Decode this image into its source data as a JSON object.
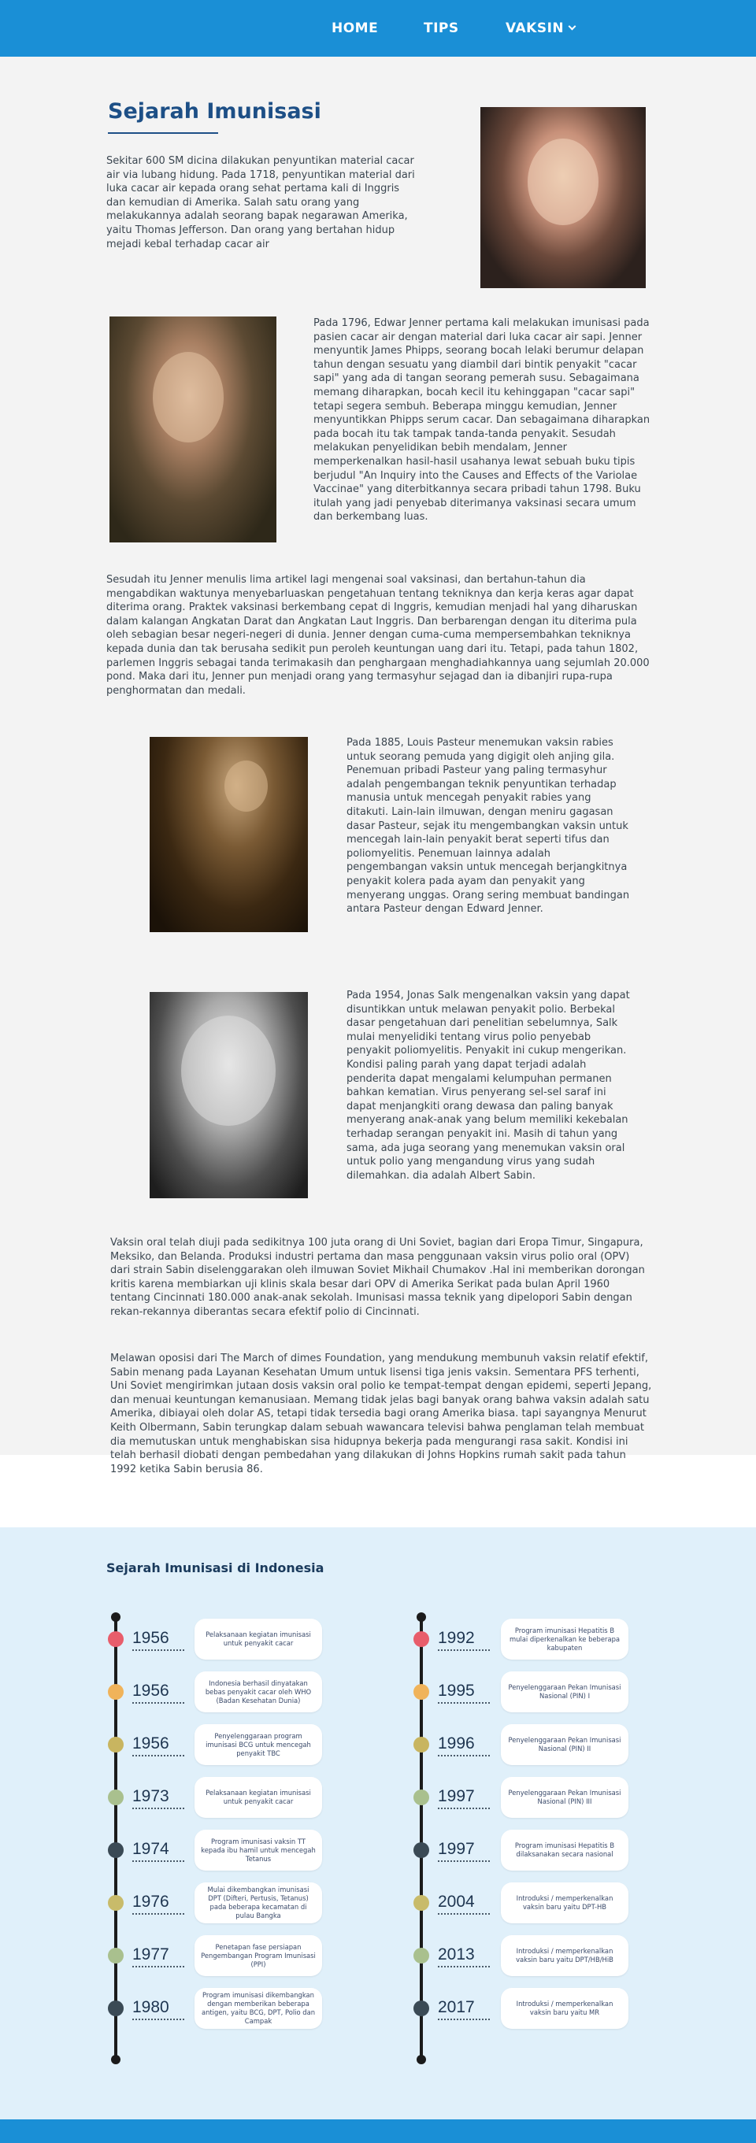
{
  "nav": {
    "home": "HOME",
    "tips": "TIPS",
    "vaksin": "VAKSIN"
  },
  "main": {
    "title": "Sejarah Imunisasi",
    "p1": "Sekitar 600 SM dicina dilakukan penyuntikan material cacar air via lubang hidung. Pada 1718, penyuntikan material dari luka cacar air kepada orang sehat pertama kali di Inggris dan kemudian di Amerika. Salah satu orang yang melakukannya adalah seorang bapak negarawan Amerika, yaitu Thomas Jefferson. Dan orang yang bertahan hidup mejadi kebal terhadap cacar air",
    "p2": "Pada 1796, Edwar Jenner pertama kali melakukan imunisasi pada pasien cacar air dengan material dari luka cacar air sapi. Jenner menyuntik James Phipps, seorang bocah lelaki berumur delapan tahun dengan sesuatu yang diambil dari bintik penyakit \"cacar sapi\" yang ada di tangan seorang pemerah susu. Sebagaimana memang diharapkan, bocah kecil itu kehinggapan \"cacar sapi\" tetapi segera sembuh. Beberapa minggu kemudian, Jenner menyuntikkan Phipps serum cacar. Dan sebagaimana diharapkan pada bocah itu tak tampak tanda-tanda penyakit. Sesudah melakukan penyelidikan bebih mendalam, Jenner memperkenalkan hasil-hasil usahanya lewat sebuah buku tipis berjudul \"An Inquiry into the Causes and Effects of the Variolae Vaccinae\" yang diterbitkannya secara pribadi tahun 1798. Buku itulah yang jadi penyebab diterimanya vaksinasi secara umum dan berkembang luas.",
    "p3": "Sesudah itu Jenner menulis lima artikel lagi mengenai soal vaksinasi, dan bertahun-tahun dia mengabdikan waktunya menyebarluaskan pengetahuan tentang tekniknya dan kerja keras agar dapat diterima orang. Praktek vaksinasi berkembang cepat di Inggris, kemudian menjadi hal yang diharuskan dalam kalangan Angkatan Darat dan Angkatan Laut Inggris. Dan berbarengan dengan itu diterima pula oleh sebagian besar negeri-negeri di dunia. Jenner dengan cuma-cuma mempersembahkan tekniknya kepada dunia dan tak berusaha sedikit pun peroleh keuntungan uang dari itu. Tetapi, pada tahun 1802, parlemen Inggris sebagai tanda terimakasih dan penghargaan menghadiahkannya uang sejumlah 20.000 pond. Maka dari itu, Jenner pun menjadi orang yang termasyhur sejagad dan ia dibanjiri rupa-rupa penghormatan dan medali.",
    "p4": "Pada 1885, Louis Pasteur menemukan vaksin rabies untuk seorang pemuda yang digigit oleh anjing gila. Penemuan pribadi Pasteur yang paling termasyhur adalah pengembangan teknik penyuntikan terhadap manusia untuk mencegah penyakit rabies yang ditakuti. Lain-lain ilmuwan, dengan meniru gagasan dasar Pasteur, sejak itu mengembangkan vaksin untuk mencegah lain-lain penyakit berat seperti tifus dan poliomyelitis. Penemuan lainnya adalah pengembangan vaksin untuk mencegah berjangkitnya penyakit kolera pada ayam dan penyakit yang menyerang unggas. Orang sering membuat bandingan antara Pasteur dengan Edward Jenner.",
    "p5": "Pada 1954, Jonas Salk mengenalkan vaksin yang dapat disuntikkan untuk melawan penyakit polio. Berbekal dasar pengetahuan dari penelitian sebelumnya, Salk mulai menyelidiki tentang virus polio penyebab penyakit poliomyelitis. Penyakit ini cukup mengerikan. Kondisi paling parah yang dapat terjadi adalah penderita dapat mengalami kelumpuhan permanen bahkan kematian. Virus penyerang sel-sel saraf ini dapat menjangkiti orang dewasa dan paling banyak menyerang anak-anak yang belum memiliki kekebalan terhadap serangan penyakit ini. Masih di tahun yang sama, ada juga seorang yang menemukan vaksin oral untuk polio yang mengandung virus yang sudah dilemahkan. dia adalah Albert Sabin.",
    "p6": " Vaksin oral telah diuji pada sedikitnya 100 juta orang di Uni Soviet, bagian dari Eropa Timur, Singapura, Meksiko, dan Belanda. Produksi industri pertama dan masa penggunaan vaksin virus polio oral (OPV) dari strain Sabin diselenggarakan oleh ilmuwan Soviet Mikhail Chumakov .Hal ini memberikan dorongan kritis karena membiarkan uji klinis skala besar dari OPV di Amerika Serikat pada bulan April 1960 tentang Cincinnati 180.000 anak-anak sekolah. Imunisasi massa teknik yang dipelopori Sabin dengan rekan-rekannya diberantas secara efektif polio di Cincinnati.",
    "p7": "Melawan oposisi dari The March of dimes Foundation, yang mendukung membunuh vaksin relatif efektif, Sabin menang pada Layanan Kesehatan Umum untuk lisensi tiga jenis vaksin. Sementara PFS terhenti, Uni Soviet mengirimkan jutaan dosis vaksin oral polio ke tempat-tempat dengan epidemi, seperti Jepang, dan menuai keuntungan kemanusiaan. Memang tidak jelas bagi banyak orang bahwa vaksin adalah satu Amerika, dibiayai oleh dolar AS, tetapi tidak tersedia bagi orang Amerika biasa. tapi sayangnya Menurut Keith Olbermann, Sabin terungkap dalam sebuah wawancara televisi bahwa penglaman telah membuat dia memutuskan untuk menghabiskan sisa hidupnya bekerja pada mengurangi rasa sakit. Kondisi ini telah berhasil diobati dengan pembedahan yang dilakukan di Johns Hopkins rumah sakit pada tahun 1992 ketika Sabin berusia 86."
  },
  "timeline": {
    "title": "Sejarah Imunisasi di Indonesia",
    "left": [
      {
        "year": "1956",
        "color": "#e85d6b",
        "text": "Pelaksanaan kegiatan imunisasi untuk penyakit cacar"
      },
      {
        "year": "1956",
        "color": "#f0b35a",
        "text": "Indonesia berhasil dinyatakan bebas penyakit cacar oleh WHO (Badan Kesehatan Dunia)"
      },
      {
        "year": "1956",
        "color": "#c8b560",
        "text": "Penyelenggaraan program imunisasi BCG untuk mencegah penyakit TBC"
      },
      {
        "year": "1973",
        "color": "#a9c08e",
        "text": "Pelaksanaan kegiatan imunisasi untuk penyakit cacar"
      },
      {
        "year": "1974",
        "color": "#3a4a55",
        "text": "Program imunisasi vaksin TT kepada ibu hamil untuk mencegah Tetanus"
      },
      {
        "year": "1976",
        "color": "#c8bb6a",
        "text": "Mulai dikembangkan imunisasi DPT (Difteri, Pertusis, Tetanus) pada beberapa kecamatan di pulau Bangka"
      },
      {
        "year": "1977",
        "color": "#a9c08e",
        "text": "Penetapan fase persiapan Pengembangan Program Imunisasi (PPI)"
      },
      {
        "year": "1980",
        "color": "#3a4a55",
        "text": "Program imunisasi dikembangkan dengan memberikan beberapa antigen, yaitu BCG, DPT, Polio dan Campak"
      }
    ],
    "right": [
      {
        "year": "1992",
        "color": "#e85d6b",
        "text": "Program imunisasi Hepatitis B mulai diperkenalkan ke beberapa kabupaten"
      },
      {
        "year": "1995",
        "color": "#f0b35a",
        "text": "Penyelenggaraan Pekan Imunisasi Nasional (PIN) I"
      },
      {
        "year": "1996",
        "color": "#c8b560",
        "text": "Penyelenggaraan Pekan Imunisasi Nasional (PIN) II"
      },
      {
        "year": "1997",
        "color": "#a9c08e",
        "text": "Penyelenggaraan Pekan Imunisasi Nasional (PIN) III"
      },
      {
        "year": "1997",
        "color": "#3a4a55",
        "text": "Program imunisasi Hepatitis B dilaksanakan secara nasional"
      },
      {
        "year": "2004",
        "color": "#c8bb6a",
        "text": "Introduksi / memperkenalkan vaksin baru yaitu DPT-HB"
      },
      {
        "year": "2013",
        "color": "#a9c08e",
        "text": "Introduksi / memperkenalkan vaksin baru yaitu DPT/HB/HiB"
      },
      {
        "year": "2017",
        "color": "#3a4a55",
        "text": "Introduksi / memperkenalkan vaksin baru yaitu MR"
      }
    ]
  }
}
